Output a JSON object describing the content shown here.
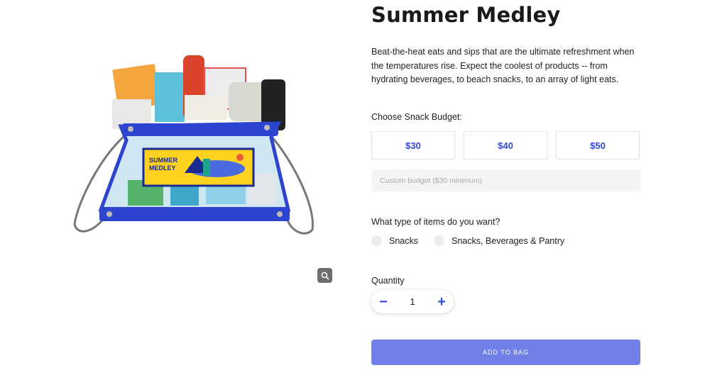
{
  "product": {
    "title": "Summer Medley",
    "description": "Beat-the-heat eats and sips that are the ultimate refreshment when the temperatures rise.  Expect the coolest of products -- from hydrating beverages, to beach snacks, to an array of light eats.",
    "image_label_line1": "SUMMER",
    "image_label_line2": "MEDLEY",
    "zoom_icon": "search-icon"
  },
  "budget": {
    "label": "Choose Snack Budget:",
    "options": [
      "$30",
      "$40",
      "$50"
    ],
    "custom_placeholder": "Custom budget ($30 minimum)"
  },
  "items": {
    "label": "What type of items do you want?",
    "options": [
      "Snacks",
      "Snacks, Beverages & Pantry"
    ]
  },
  "quantity": {
    "label": "Quantity",
    "value": "1",
    "minus": "−",
    "plus": "+"
  },
  "cart": {
    "add_label": "ADD TO BAG"
  },
  "colors": {
    "accent": "#3447d6",
    "button": "#7080e8"
  }
}
